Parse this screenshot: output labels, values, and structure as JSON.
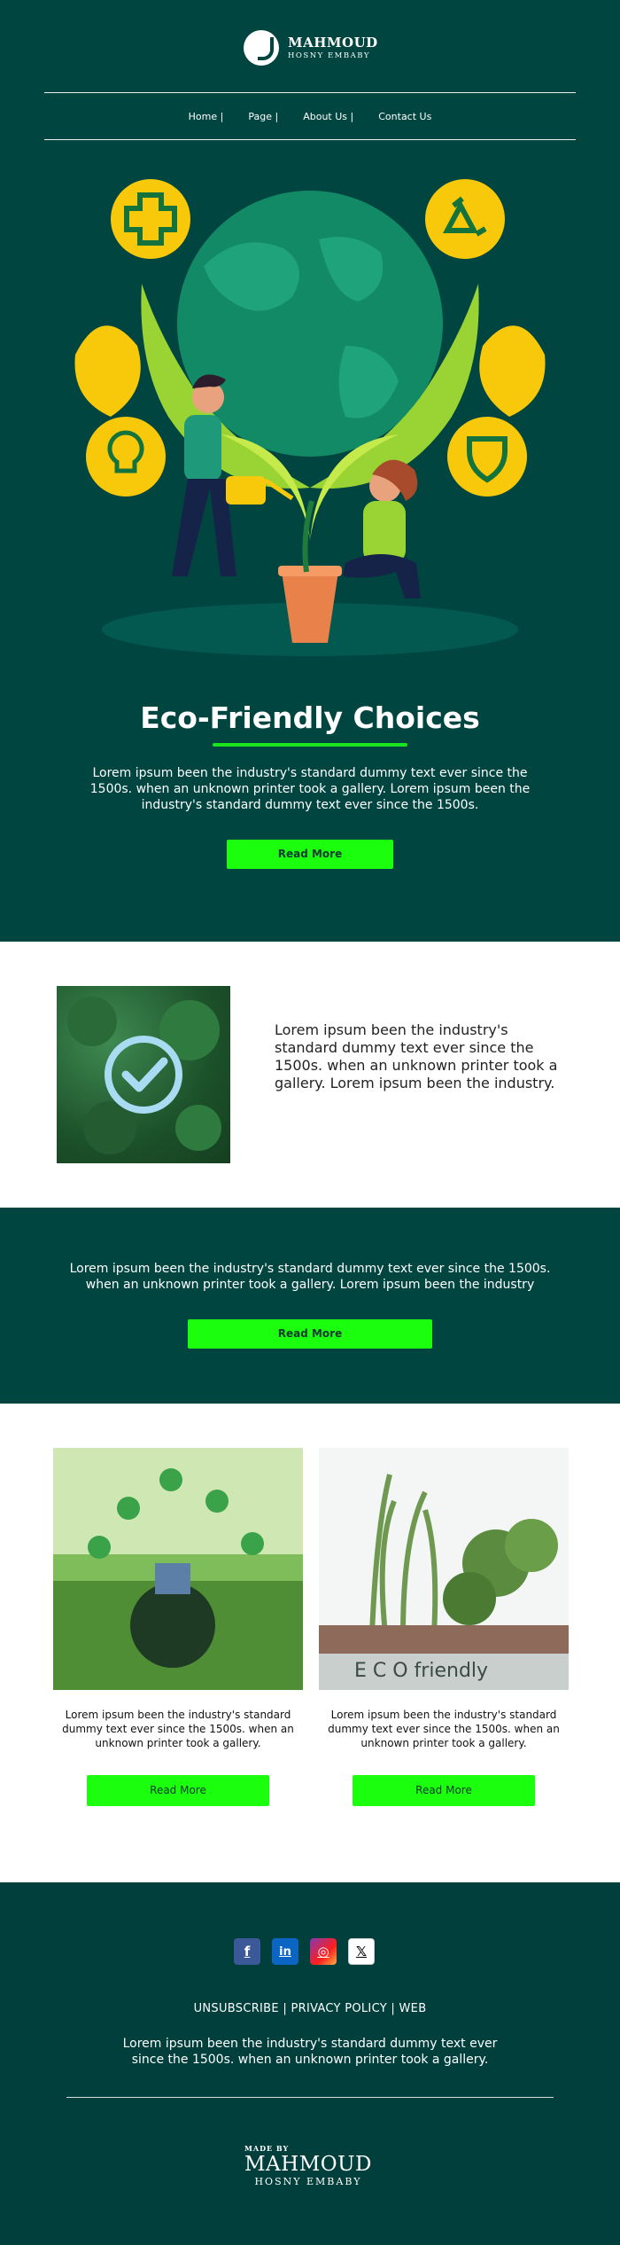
{
  "brand": {
    "name": "MAHMOUD",
    "sub": "HOSNY EMBABY"
  },
  "nav": [
    {
      "label": "Home",
      "sep": "|"
    },
    {
      "label": "Page",
      "sep": "|"
    },
    {
      "label": "About Us",
      "sep": "|"
    },
    {
      "label": "Contact Us",
      "sep": ""
    }
  ],
  "hero": {
    "title": "Eco-Friendly Choices",
    "text": "Lorem ipsum been the industry's standard dummy text ever since the 1500s. when an unknown printer took a gallery. Lorem ipsum been the industry's standard dummy text ever since the 1500s.",
    "button": "Read More"
  },
  "feature": {
    "text": "Lorem ipsum been the industry's standard dummy text ever since the 1500s. when an unknown printer took a gallery. Lorem ipsum been the industry."
  },
  "band": {
    "text": "Lorem ipsum been the industry's standard dummy text ever since the 1500s. when an unknown printer took a gallery. Lorem ipsum been the industry",
    "button": "Read More"
  },
  "cards": [
    {
      "text": "Lorem ipsum been the industry's standard dummy text ever since the 1500s. when an unknown printer took a gallery.",
      "button": "Read More"
    },
    {
      "text": "Lorem ipsum been the industry's standard dummy text ever since the 1500s. when an unknown printer took a gallery.",
      "button": "Read More",
      "image_caption": "E C O   friendly"
    }
  ],
  "footer": {
    "socials": [
      {
        "name": "facebook-icon",
        "glyph": "f"
      },
      {
        "name": "linkedin-icon",
        "glyph": "in"
      },
      {
        "name": "instagram-icon",
        "glyph": "◎"
      },
      {
        "name": "x-icon",
        "glyph": "𝕏"
      }
    ],
    "links": [
      "UNSUBSCRIBE",
      "PRIVACY POLICY",
      "WEB"
    ],
    "link_sep": "|",
    "text": "Lorem ipsum been the industry's standard dummy text ever since the 1500s. when an unknown printer took a gallery.",
    "made_by": "MADE BY",
    "made_name": "MAHMOUD",
    "made_sub": "HOSNY EMBABY"
  },
  "colors": {
    "dark_green": "#014540",
    "accent": "#1bff0f",
    "underline": "#19e41c"
  }
}
